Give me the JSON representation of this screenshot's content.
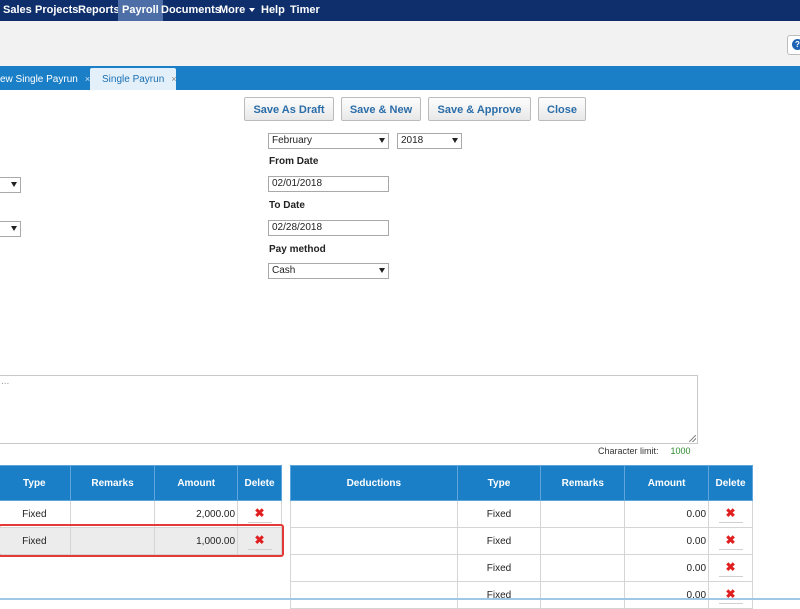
{
  "nav": {
    "items": [
      "Sales",
      "Projects",
      "Reports",
      "Payroll",
      "Documents",
      "More",
      "Help",
      "Timer"
    ],
    "active": "Payroll"
  },
  "tabs": [
    {
      "label": "ew Single Payrun",
      "close": "×"
    },
    {
      "label": "Single Payrun",
      "close": "×"
    }
  ],
  "help_icon": "?",
  "actions": {
    "save_draft": "Save As Draft",
    "save_new": "Save & New",
    "save_approve": "Save & Approve",
    "close": "Close"
  },
  "form": {
    "month": "February",
    "year": "2018",
    "from_date_label": "From Date",
    "from_date": "02/01/2018",
    "to_date_label": "To Date",
    "to_date": "02/28/2018",
    "pay_method_label": "Pay method",
    "pay_method": "Cash"
  },
  "notes": {
    "placeholder": "...",
    "char_limit_label": "Character limit:",
    "char_limit": "1000"
  },
  "earnings": {
    "headers": [
      "Type",
      "Remarks",
      "Amount",
      "Delete"
    ],
    "rows": [
      {
        "type": "Fixed",
        "remarks": "",
        "amount": "2,000.00"
      },
      {
        "type": "Fixed",
        "remarks": "",
        "amount": "1,000.00"
      }
    ]
  },
  "deductions": {
    "headers": [
      "Deductions",
      "Type",
      "Remarks",
      "Amount",
      "Delete"
    ],
    "rows": [
      {
        "name": "",
        "type": "Fixed",
        "remarks": "",
        "amount": "0.00"
      },
      {
        "name": "",
        "type": "Fixed",
        "remarks": "",
        "amount": "0.00"
      },
      {
        "name": "",
        "type": "Fixed",
        "remarks": "",
        "amount": "0.00"
      },
      {
        "name": "",
        "type": "Fixed",
        "remarks": "",
        "amount": "0.00"
      }
    ]
  },
  "delete_glyph": "✖",
  "colors": {
    "nav_bg": "#0e2f6b",
    "accent": "#1a7fc7",
    "button_text": "#2a6da8",
    "delete": "#e02020",
    "highlight_border": "#e53935"
  }
}
